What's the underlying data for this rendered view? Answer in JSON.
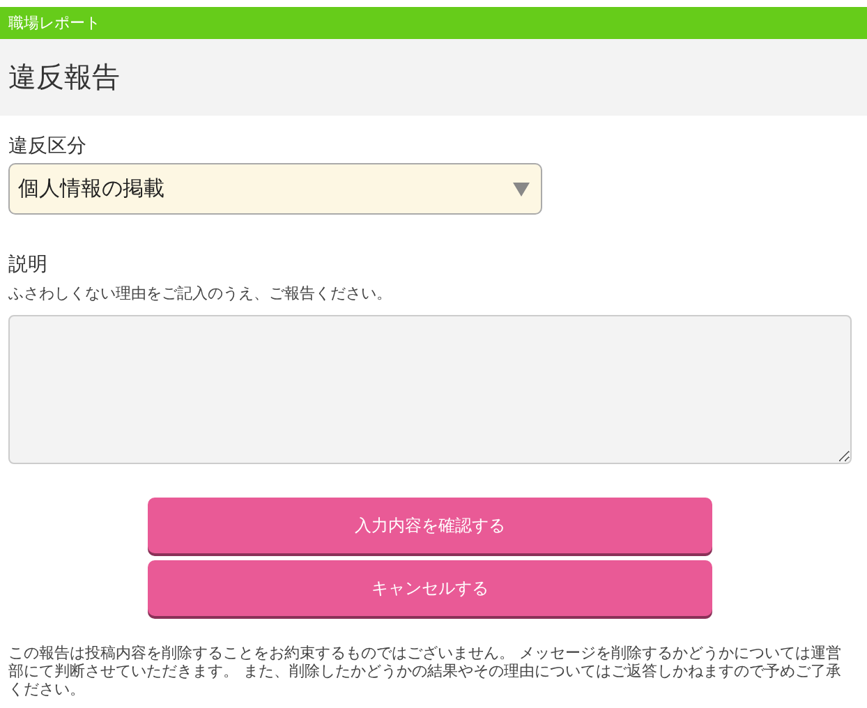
{
  "header_bar": {
    "title": "職場レポート"
  },
  "page_title": "違反報告",
  "category": {
    "label": "違反区分",
    "value": "個人情報の掲載"
  },
  "description": {
    "label": "説明",
    "hint": "ふさわしくない理由をご記入のうえ、ご報告ください。"
  },
  "buttons": [
    {
      "label": "入力内容を確認する"
    },
    {
      "label": "キャンセルする"
    }
  ],
  "notice": "この報告は投稿内容を削除することをお約束するものではございません。 メッセージを削除するかどうかについては運営部にて判断させていただきます。 また、削除したかどうかの結果やその理由についてはご返答しかねますので予めご了承ください。"
}
